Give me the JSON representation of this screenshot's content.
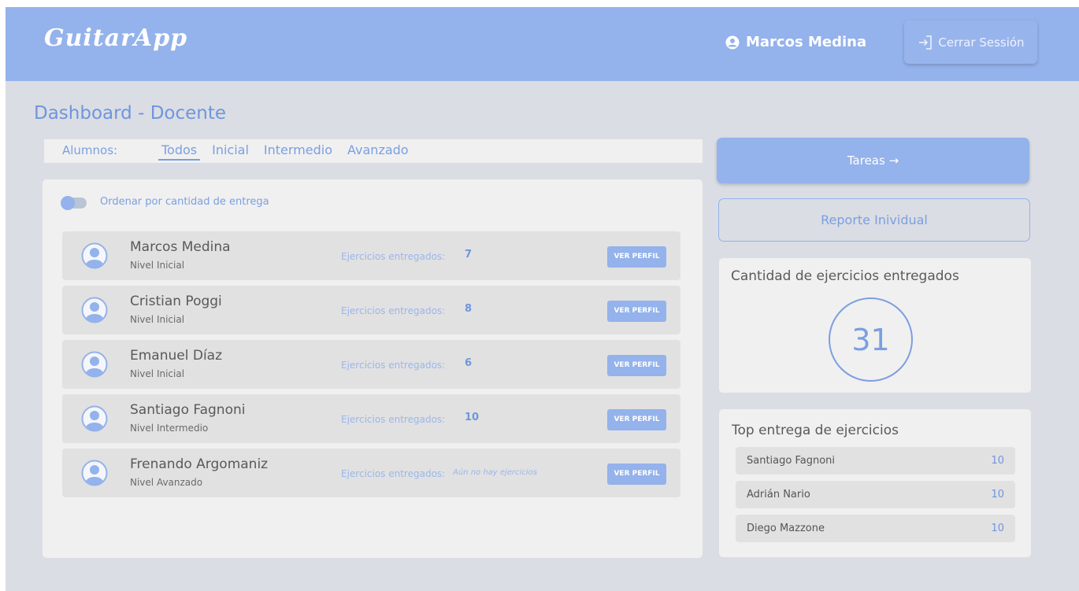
{
  "header": {
    "logo": "GuitarApp",
    "user_name": "Marcos Medina",
    "logout_label": "Cerrar Sessión"
  },
  "page": {
    "title": "Dashboard - Docente"
  },
  "filters": {
    "label": "Alumnos:",
    "tabs": [
      "Todos",
      "Inicial",
      "Intermedio",
      "Avanzado"
    ],
    "active": "Todos"
  },
  "sort": {
    "label": "Ordenar por cantidad de entrega",
    "enabled": false
  },
  "students": [
    {
      "name": "Marcos Medina",
      "level": "Nivel Inicial",
      "ejercicios_label": "Ejercicios entregados:",
      "ejercicios": "7",
      "button": "VER PERFIL"
    },
    {
      "name": "Cristian Poggi",
      "level": "Nivel Inicial",
      "ejercicios_label": "Ejercicios entregados:",
      "ejercicios": "8",
      "button": "VER PERFIL"
    },
    {
      "name": "Emanuel Díaz",
      "level": "Nivel Inicial",
      "ejercicios_label": "Ejercicios entregados:",
      "ejercicios": "6",
      "button": "VER PERFIL"
    },
    {
      "name": "Santiago Fagnoni",
      "level": "Nivel Intermedio",
      "ejercicios_label": "Ejercicios entregados:",
      "ejercicios": "10",
      "button": "VER PERFIL"
    },
    {
      "name": "Frenando Argomaniz",
      "level": "Nivel Avanzado",
      "ejercicios_label": "Ejercicios entregados:",
      "ejercicios": "Aún no hay ejercicios",
      "button": "VER PERFIL"
    }
  ],
  "actions": {
    "tareas": "Tareas →",
    "reporte": "Reporte Inividual"
  },
  "count_card": {
    "title": "Cantidad de ejercicios entregados",
    "value": "31"
  },
  "top_card": {
    "title": "Top entrega de ejercicios",
    "items": [
      {
        "name": "Santiago Fagnoni",
        "value": "10"
      },
      {
        "name": "Adrián Nario",
        "value": "10"
      },
      {
        "name": "Diego Mazzone",
        "value": "10"
      }
    ]
  },
  "colors": {
    "header": "#94b2eb",
    "accent": "#7b9fe0",
    "background": "#dadde3",
    "panel": "#f0f0f0"
  },
  "icons": {
    "user": "user-circle-icon",
    "logout": "sign-in-icon",
    "avatar": "avatar-icon"
  }
}
